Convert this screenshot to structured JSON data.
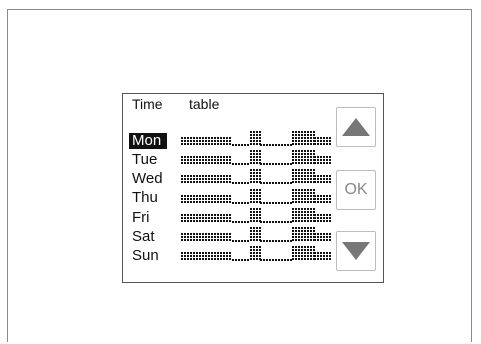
{
  "screen": {
    "title_left": "Time",
    "title_right": "table"
  },
  "days": [
    "Mon",
    "Tue",
    "Wed",
    "Thu",
    "Fri",
    "Sat",
    "Sun"
  ],
  "selected_day_index": 0,
  "buttons": {
    "up_icon": "triangle-up-icon",
    "ok_label": "OK",
    "down_icon": "triangle-down-icon"
  },
  "colors": {
    "lcd_text": "#111111",
    "button_icon": "#777777",
    "button_border": "#bdbdbd"
  }
}
